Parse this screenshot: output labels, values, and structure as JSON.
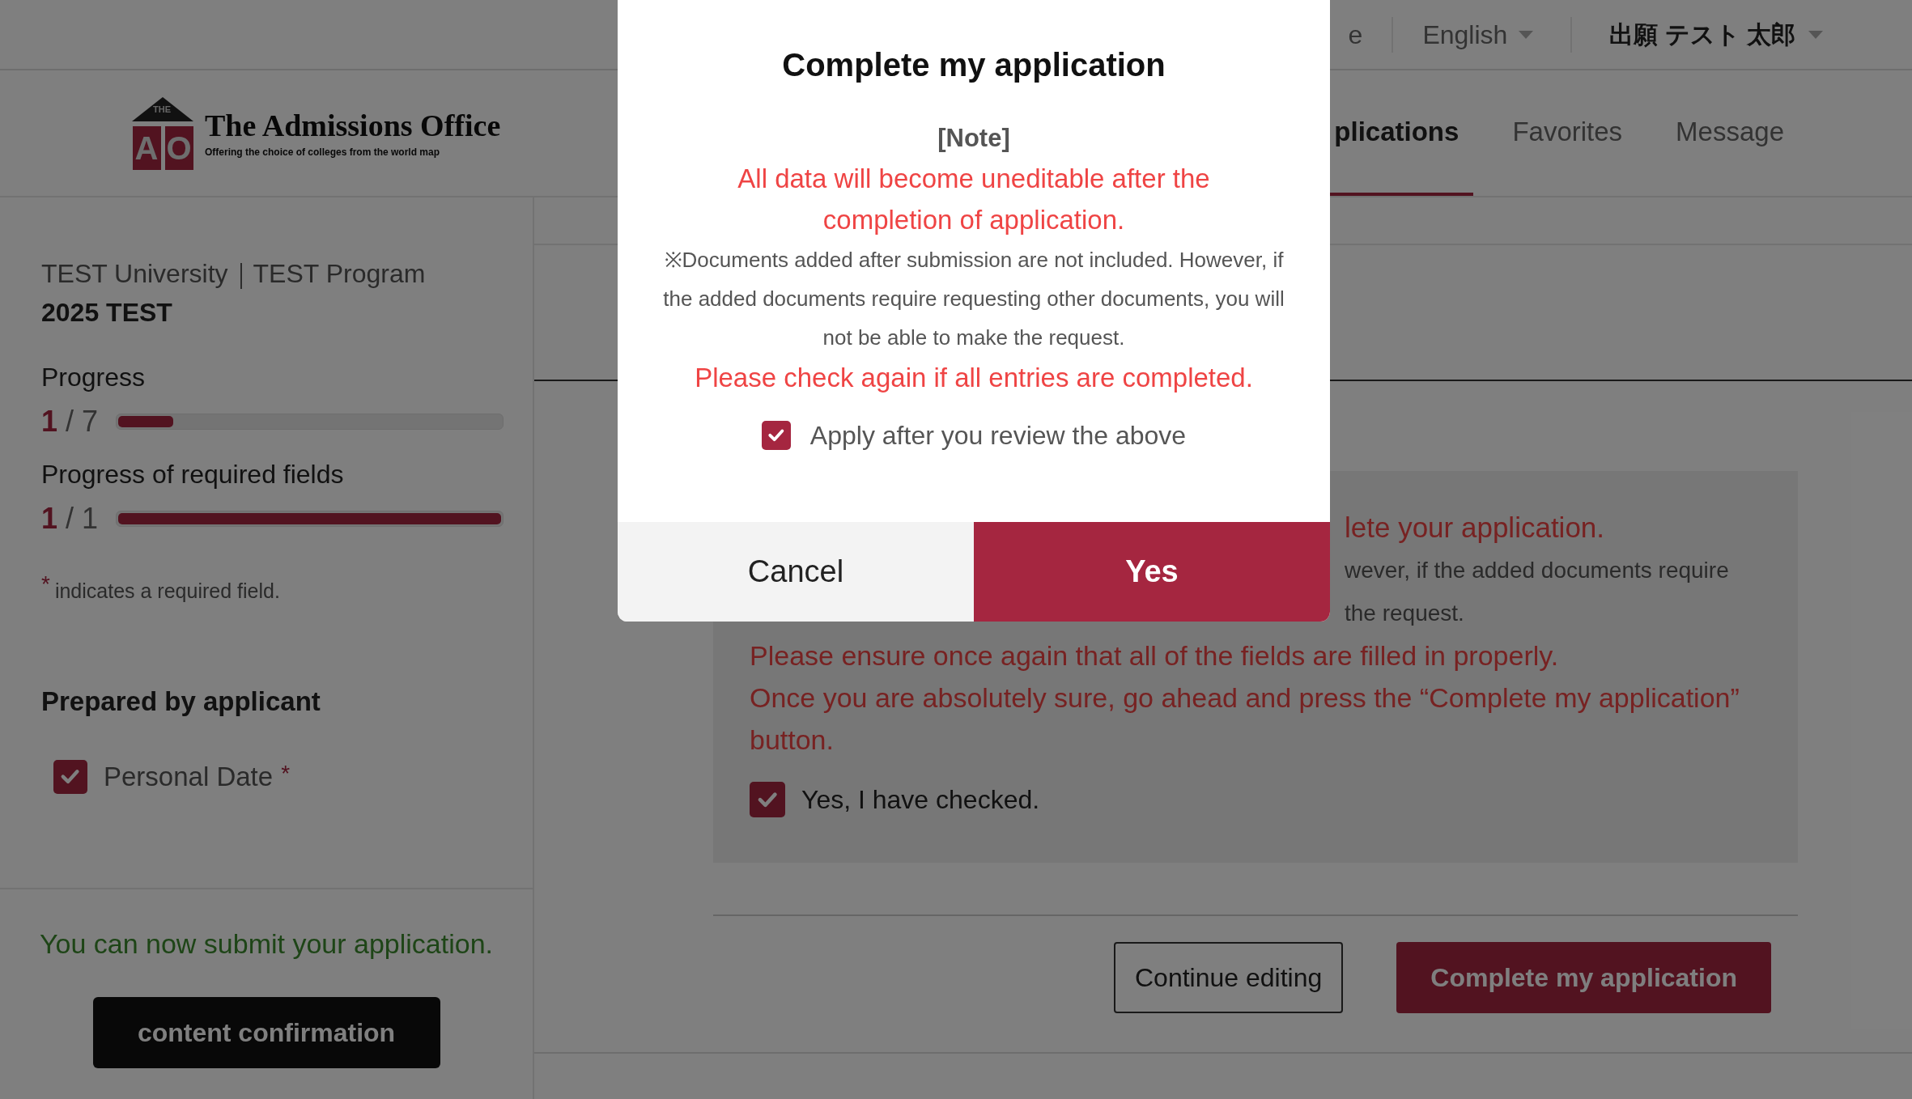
{
  "top_bar": {
    "cut_link": "e",
    "language": "English",
    "user": "出願 テスト 太郎"
  },
  "logo": {
    "badge_top": "THE",
    "badge_letters": [
      "A",
      "O"
    ],
    "title": "The Admissions Office",
    "subtitle": "Offering the choice of colleges from the world map"
  },
  "nav_tabs": [
    {
      "label": "plications",
      "selected": true
    },
    {
      "label": "Favorites",
      "selected": false
    },
    {
      "label": "Message",
      "selected": false
    }
  ],
  "sidebar": {
    "program": "TEST University｜TEST Program",
    "year": "2025 TEST",
    "progress": [
      {
        "title": "Progress",
        "done": "1",
        "total": "/ 7",
        "level": 0.144
      },
      {
        "title": "Progress of required fields",
        "done": "1",
        "total": "/ 1",
        "level": 1
      }
    ],
    "required_mark": "*",
    "required_note": "indicates a required field.",
    "section_title": "Prepared by applicant",
    "items": [
      {
        "label": "Personal Date",
        "required_mark": "*",
        "checked": true
      }
    ],
    "status": "You can now submit your application.",
    "confirm_button": "content confirmation"
  },
  "main": {
    "notice": {
      "cut_lines": [
        {
          "text": "lete your application.",
          "kind": "alert"
        },
        {
          "text": "wever, if the added documents require",
          "kind": "info"
        },
        {
          "text": "the request.",
          "kind": "info"
        }
      ],
      "lines": [
        {
          "text": "Please ensure once again that all of the fields are filled in properly.",
          "kind": "alert"
        },
        {
          "text": "Once you are absolutely sure, go ahead and press the “Complete my application” button.",
          "kind": "alert"
        }
      ],
      "confirm": {
        "label": "Yes, I have checked.",
        "checked": true
      }
    },
    "buttons": [
      {
        "label": "Continue editing",
        "kind": "outline"
      },
      {
        "label": "Complete my application",
        "kind": "primary"
      }
    ]
  },
  "modal": {
    "title": "Complete my application",
    "note_heading": "[Note]",
    "lines": [
      {
        "text": "All data will become uneditable after the completion of application.",
        "kind": "alert"
      },
      {
        "text": "※Documents added after submission are not included. However, if the added documents require requesting other documents, you will not be able to make the request.",
        "kind": "info"
      },
      {
        "text": "Please check again if all entries are completed.",
        "kind": "alert"
      }
    ],
    "agree": {
      "label": "Apply after you review the above",
      "checked": true
    },
    "buttons": [
      {
        "label": "Cancel",
        "kind": "secondary"
      },
      {
        "label": "Yes",
        "kind": "primary"
      }
    ]
  }
}
